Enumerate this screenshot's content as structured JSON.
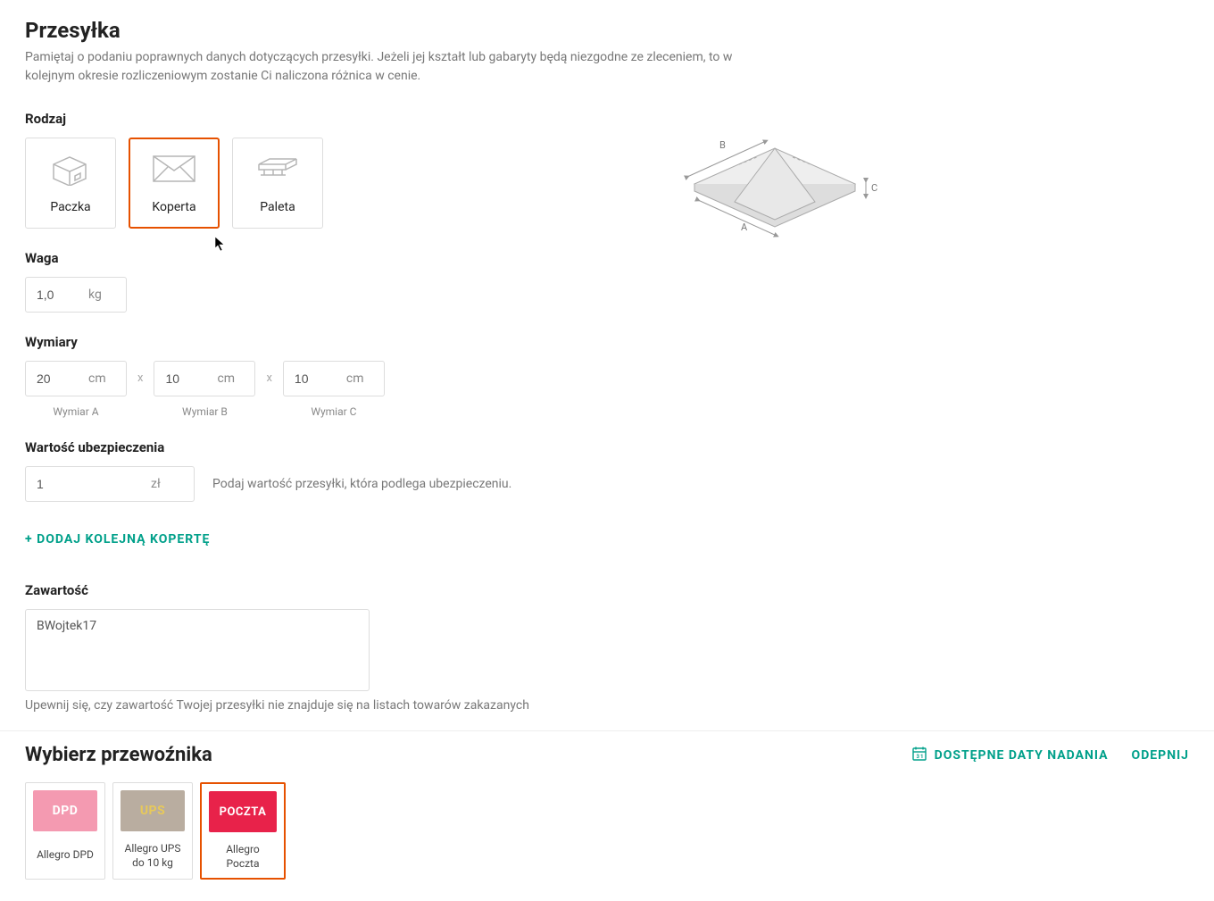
{
  "shipment": {
    "title": "Przesyłka",
    "desc": "Pamiętaj o podaniu poprawnych danych dotyczących przesyłki. Jeżeli jej kształt lub gabaryty będą niezgodne ze zleceniem, to w kolejnym okresie rozliczeniowym zostanie Ci naliczona różnica w cenie.",
    "type_label": "Rodzaj",
    "types": [
      {
        "id": "paczka",
        "label": "Paczka"
      },
      {
        "id": "koperta",
        "label": "Koperta"
      },
      {
        "id": "paleta",
        "label": "Paleta"
      }
    ],
    "selected_type": 1,
    "weight": {
      "label": "Waga",
      "value": "1,0",
      "unit": "kg"
    },
    "dimensions": {
      "label": "Wymiary",
      "a": {
        "value": "20",
        "unit": "cm",
        "caption": "Wymiar A"
      },
      "b": {
        "value": "10",
        "unit": "cm",
        "caption": "Wymiar B"
      },
      "c": {
        "value": "10",
        "unit": "cm",
        "caption": "Wymiar C"
      },
      "sep": "x"
    },
    "insurance": {
      "label": "Wartość ubezpieczenia",
      "value": "1",
      "unit": "zł",
      "hint": "Podaj wartość przesyłki, która podlega ubezpieczeniu."
    },
    "add_button": "+  DODAJ KOLEJNĄ KOPERTĘ",
    "content": {
      "label": "Zawartość",
      "value": "BWojtek17",
      "note": "Upewnij się, czy zawartość Twojej przesyłki nie znajduje się na listach towarów zakazanych"
    },
    "illustration": {
      "a": "A",
      "b": "B",
      "c": "C"
    }
  },
  "carrier": {
    "title": "Wybierz przewoźnika",
    "dates_link": "DOSTĘPNE DATY NADANIA",
    "unpin_link": "ODEPNIJ",
    "options": [
      {
        "badge": "DPD",
        "label": "Allegro DPD",
        "class": "badge-dpd"
      },
      {
        "badge": "UPS",
        "label": "Allegro UPS do 10 kg",
        "class": "badge-ups"
      },
      {
        "badge": "POCZTA",
        "label": "Allegro Poczta",
        "class": "badge-poczta"
      }
    ],
    "selected": 2
  }
}
